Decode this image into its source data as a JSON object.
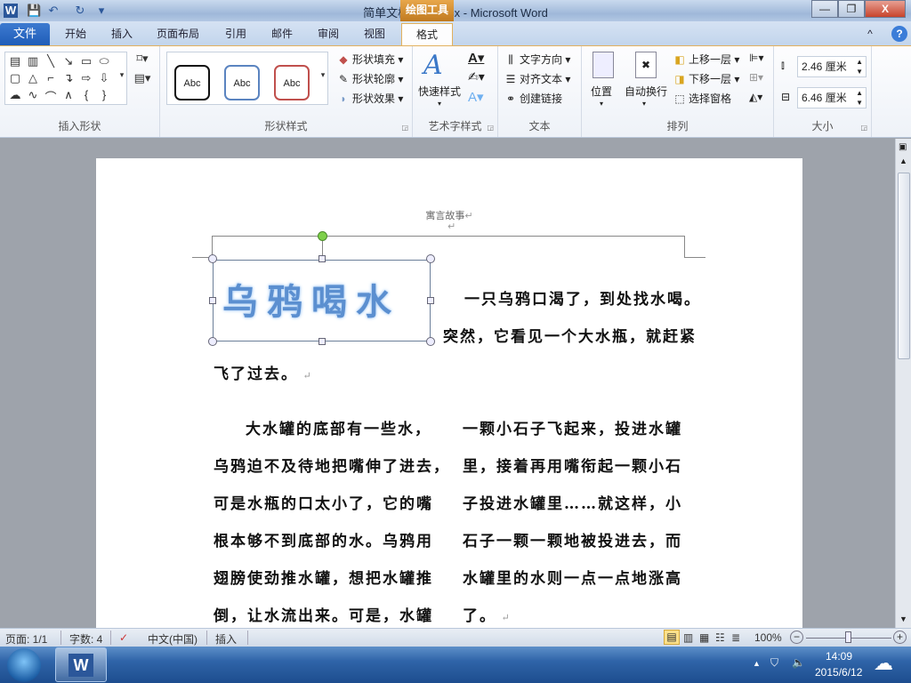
{
  "window": {
    "title": "简单文档排版.docx - Microsoft Word",
    "contextual_tab": "绘图工具",
    "minimize": "—",
    "restore": "❐",
    "close": "X"
  },
  "quick_access": {
    "word_icon": "W",
    "save": "💾",
    "undo": "↶",
    "redo": "↻",
    "customize": "▾"
  },
  "tabs": {
    "file": "文件",
    "items": [
      "开始",
      "插入",
      "页面布局",
      "引用",
      "邮件",
      "审阅",
      "视图"
    ],
    "active": "格式",
    "collapse": "^",
    "help": "?"
  },
  "ribbon": {
    "insert_shapes": {
      "label": "插入形状",
      "shapes": [
        "▤",
        "▥",
        "╲",
        "↘",
        "▭",
        "⬭",
        "▢",
        "△",
        "⌐",
        "↴",
        "⇨",
        "⇩",
        "☁",
        "∿",
        "⌒",
        "∧",
        "{",
        "}"
      ]
    },
    "shape_styles": {
      "label": "形状样式",
      "samples": [
        "Abc",
        "Abc",
        "Abc"
      ],
      "fill": "形状填充",
      "outline": "形状轮廓",
      "effects": "形状效果"
    },
    "wordart": {
      "label": "艺术字样式",
      "quick_styles": "快速样式"
    },
    "text": {
      "label": "文本",
      "direction": "文字方向",
      "align": "对齐文本",
      "link": "创建链接"
    },
    "arrange": {
      "label": "排列",
      "position": "位置",
      "wrap": "自动换行",
      "bring_forward": "上移一层",
      "send_backward": "下移一层",
      "selection_pane": "选择窗格"
    },
    "size": {
      "label": "大小",
      "height": "2.46 厘米",
      "width": "6.46 厘米"
    }
  },
  "document": {
    "header": "寓言故事",
    "wordart": "乌鸦喝水",
    "lines_top": [
      "一只乌鸦口渴了，到处找水喝。",
      "突然，它看见一个大水瓶，就赶紧",
      "飞了过去。"
    ],
    "col_left": [
      "大水罐的底部有一些水，",
      "乌鸦迫不及待地把嘴伸了进去，",
      "可是水瓶的口太小了，它的嘴",
      "根本够不到底部的水。乌鸦用",
      "翅膀使劲推水罐，想把水罐推",
      "倒，让水流出来。可是，水罐"
    ],
    "col_right": [
      "一颗小石子飞起来，投进水罐",
      "里，接着再用嘴衔起一颗小石",
      "子投进水罐里……就这样，小",
      "石子一颗一颗地被投进去，而",
      "水罐里的水则一点一点地涨高",
      "了。"
    ]
  },
  "status": {
    "page": "页面: 1/1",
    "words": "字数: 4",
    "language": "中文(中国)",
    "mode": "插入",
    "zoom": "100%",
    "zoom_percent": 100
  },
  "taskbar": {
    "time": "14:09",
    "date": "2015/6/12"
  }
}
